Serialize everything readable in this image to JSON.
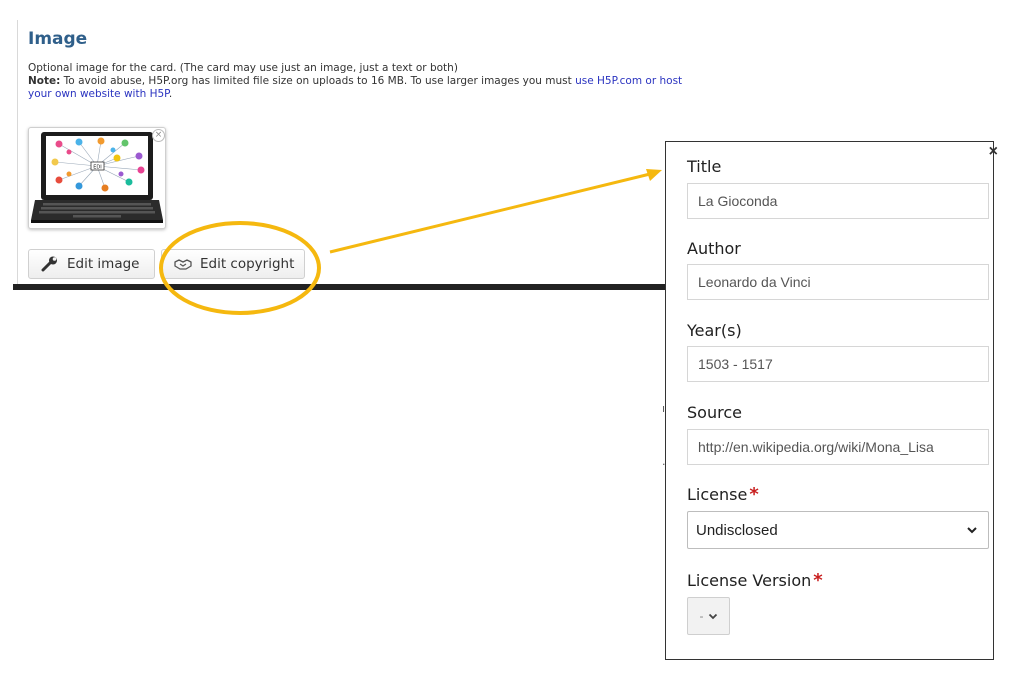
{
  "image_section": {
    "title": "Image",
    "description": "Optional image for the card. (The card may use just an image, just a text or both)",
    "note_label": "Note:",
    "note_text": " To avoid abuse, H5P.org has limited file size on uploads to 16 MB. To use larger images you must ",
    "note_link": "use H5P.com or host your own website with H5P",
    "note_end": ".",
    "thumbnail_alt": "laptop with network diagram",
    "remove_symbol": "×",
    "edit_image_label": "Edit image",
    "edit_copyright_label": "Edit copyright"
  },
  "copyright_panel": {
    "close_symbol": "×",
    "title_label": "Title",
    "title_value": "La Gioconda",
    "author_label": "Author",
    "author_value": "Leonardo da Vinci",
    "years_label": "Year(s)",
    "years_value": "1503 - 1517",
    "source_label": "Source",
    "source_value": "http://en.wikipedia.org/wiki/Mona_Lisa",
    "license_label": "License",
    "license_value": "Undisclosed",
    "license_version_label": "License Version",
    "license_version_value": "-",
    "required_marker": "*"
  },
  "colors": {
    "highlight": "#f5b80f",
    "title_blue": "#2f5f8a",
    "link_blue": "#2b34c0",
    "required_red": "#c81e1e"
  },
  "icons": {
    "edit_image": "wrench-icon",
    "edit_copyright": "handshake-icon"
  }
}
